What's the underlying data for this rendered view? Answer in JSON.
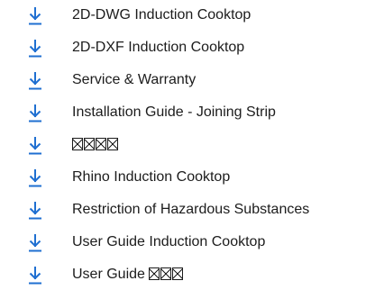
{
  "theme": {
    "icon_color": "#1f6fd1",
    "text_color": "#1c1c1c"
  },
  "downloads": [
    {
      "label": "2D-DWG Induction Cooktop",
      "icon": "download-arrow-icon"
    },
    {
      "label": "2D-DXF Induction Cooktop",
      "icon": "download-arrow-icon"
    },
    {
      "label": "Service & Warranty",
      "icon": "download-arrow-icon"
    },
    {
      "label": "Installation Guide - Joining Strip",
      "icon": "download-arrow-icon"
    },
    {
      "label": "",
      "unrendered_glyphs": 4,
      "icon": "download-arrow-icon"
    },
    {
      "label": "Rhino Induction Cooktop",
      "icon": "download-arrow-icon"
    },
    {
      "label": "Restriction of Hazardous Substances",
      "icon": "download-arrow-icon"
    },
    {
      "label": "User Guide Induction Cooktop",
      "icon": "download-arrow-icon"
    },
    {
      "label": "User Guide ",
      "unrendered_glyphs": 3,
      "icon": "download-arrow-icon"
    }
  ]
}
